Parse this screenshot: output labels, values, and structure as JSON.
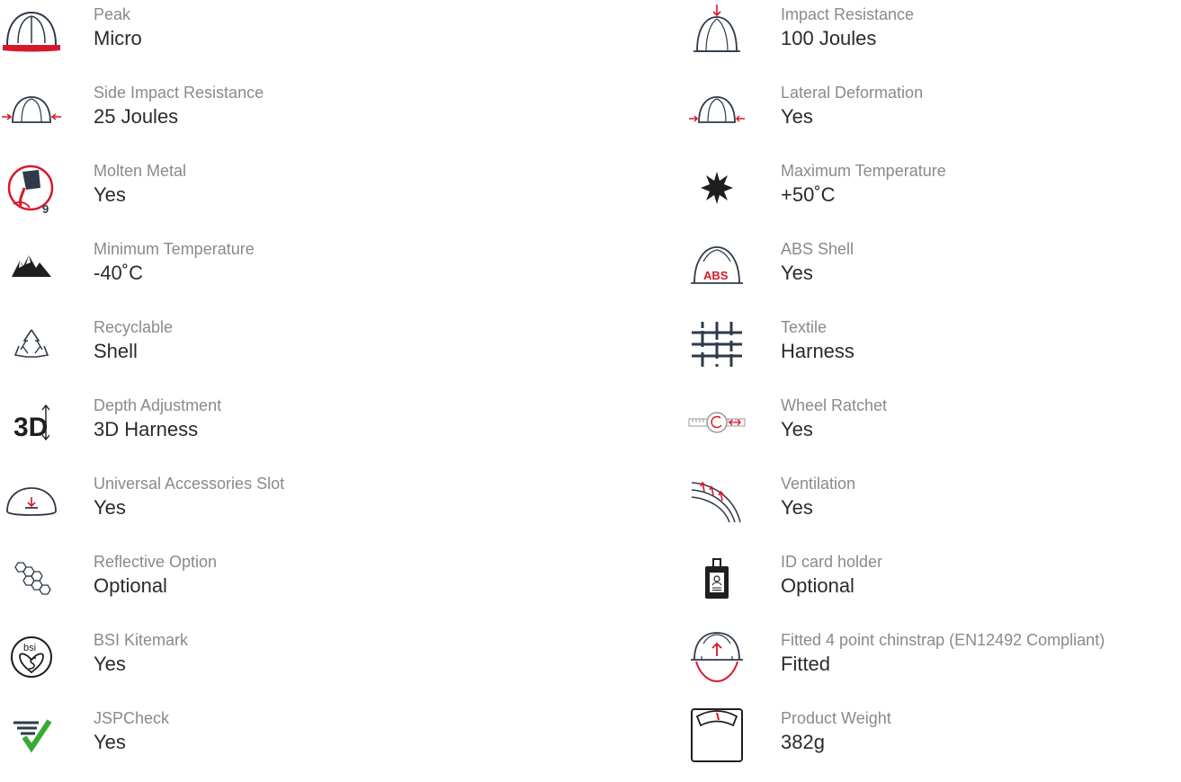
{
  "colors": {
    "accent": "#d7182a",
    "icon": "#2f3a4a",
    "label": "#8a8a8a",
    "value": "#2b2b2b",
    "check": "#3aaa35"
  },
  "left_features": [
    {
      "label": "Peak",
      "value": "Micro",
      "icon": "helmet-peak-icon"
    },
    {
      "label": "Side Impact Resistance",
      "value": "25 Joules",
      "icon": "side-impact-icon"
    },
    {
      "label": "Molten Metal",
      "value": "Yes",
      "icon": "molten-metal-icon",
      "icon_text": "9"
    },
    {
      "label": "Minimum Temperature",
      "value": "-40˚C",
      "icon": "mountains-icon"
    },
    {
      "label": "Recyclable",
      "value": "Shell",
      "icon": "recycle-icon"
    },
    {
      "label": "Depth Adjustment",
      "value": "3D Harness",
      "icon": "3d-depth-icon",
      "icon_text": "3D"
    },
    {
      "label": "Universal Accessories Slot",
      "value": "Yes",
      "icon": "accessory-slot-icon"
    },
    {
      "label": "Reflective Option",
      "value": "Optional",
      "icon": "hexagon-reflective-icon"
    },
    {
      "label": "BSI Kitemark",
      "value": "Yes",
      "icon": "bsi-kitemark-icon",
      "icon_text": "bsi"
    },
    {
      "label": "JSPCheck",
      "value": "Yes",
      "icon": "jspcheck-icon"
    }
  ],
  "right_features": [
    {
      "label": "Impact Resistance",
      "value": "100 Joules",
      "icon": "impact-resistance-icon"
    },
    {
      "label": "Lateral Deformation",
      "value": "Yes",
      "icon": "lateral-deformation-icon"
    },
    {
      "label": "Maximum Temperature",
      "value": "+50˚C",
      "icon": "sun-icon"
    },
    {
      "label": "ABS Shell",
      "value": "Yes",
      "icon": "abs-shell-icon",
      "icon_text": "ABS"
    },
    {
      "label": "Textile",
      "value": "Harness",
      "icon": "textile-weave-icon"
    },
    {
      "label": "Wheel Ratchet",
      "value": "Yes",
      "icon": "wheel-ratchet-icon"
    },
    {
      "label": "Ventilation",
      "value": "Yes",
      "icon": "ventilation-icon"
    },
    {
      "label": "ID card holder",
      "value": "Optional",
      "icon": "id-card-holder-icon"
    },
    {
      "label": "Fitted 4 point chinstrap (EN12492 Compliant)",
      "value": "Fitted",
      "icon": "chinstrap-icon"
    },
    {
      "label": "Product Weight",
      "value": "382g",
      "icon": "weight-scale-icon"
    }
  ]
}
